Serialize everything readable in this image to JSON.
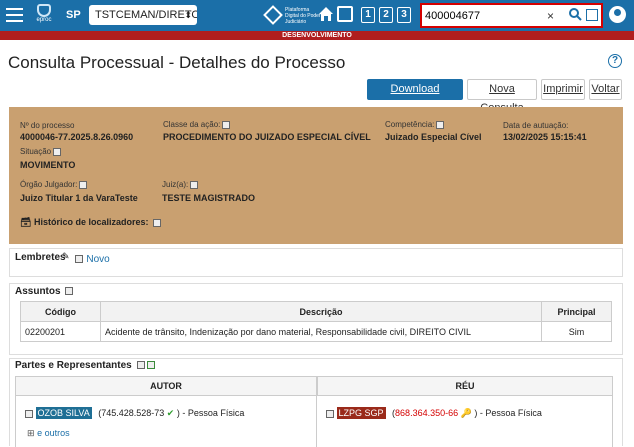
{
  "topbar": {
    "app_label": "eproc",
    "state": "SP",
    "select_value": "TSTCEMAN/DIRETOF",
    "pdpj_text": "Plataforma Digital do Poder Judiciário",
    "quick_buttons": [
      "1",
      "2",
      "3"
    ],
    "search_value": "400004677",
    "clear_label": "×"
  },
  "env_banner": "DESENVOLVIMENTO",
  "page": {
    "title": "Consulta Processual - Detalhes do Processo",
    "help_label": "?"
  },
  "toolbar": {
    "download": "Download Completo",
    "nova_consulta": "Nova Consulta",
    "imprimir": "Imprimir",
    "voltar": "Voltar"
  },
  "processo": {
    "numero_label": "Nº do processo",
    "numero": "4000046-77.2025.8.26.0960",
    "classe_label": "Classe da ação:",
    "classe": "PROCEDIMENTO DO JUIZADO ESPECIAL CÍVEL",
    "competencia_label": "Competência:",
    "competencia": "Juizado Especial Cível",
    "data_label": "Data de autuação:",
    "data": "13/02/2025 15:15:41",
    "situacao_label": "Situação",
    "situacao": "MOVIMENTO",
    "orgao_label": "Órgão Julgador:",
    "orgao": "Juizo Titular 1 da VaraTeste",
    "juiz_label": "Juiz(a):",
    "juiz": "TESTE MAGISTRADO",
    "historico": "Histórico de localizadores:"
  },
  "lembretes": {
    "title": "Lembretes",
    "novo": "Novo"
  },
  "assuntos": {
    "title": "Assuntos",
    "headers": [
      "Código",
      "Descrição",
      "Principal"
    ],
    "rows": [
      [
        "02200201",
        "Acidente de trânsito, Indenização por dano material, Responsabilidade civil, DIREITO CIVIL",
        "Sim"
      ]
    ]
  },
  "partes": {
    "title": "Partes e Representantes",
    "autor_header": "AUTOR",
    "reu_header": "RÉU",
    "autor_name": "OZOB SILVA",
    "autor_doc": "(745.428.528-73",
    "autor_tipo": ") - Pessoa Física",
    "reu_name": "LZPG SGP",
    "reu_open": "(",
    "reu_doc": "868.364.350-66",
    "reu_tipo": ") - Pessoa Física",
    "e_outros": "e outros",
    "colors": {
      "autor_tag": "#1f6f95",
      "reu_tag": "#9a2a1a",
      "reu_doc": "#d40000"
    }
  }
}
